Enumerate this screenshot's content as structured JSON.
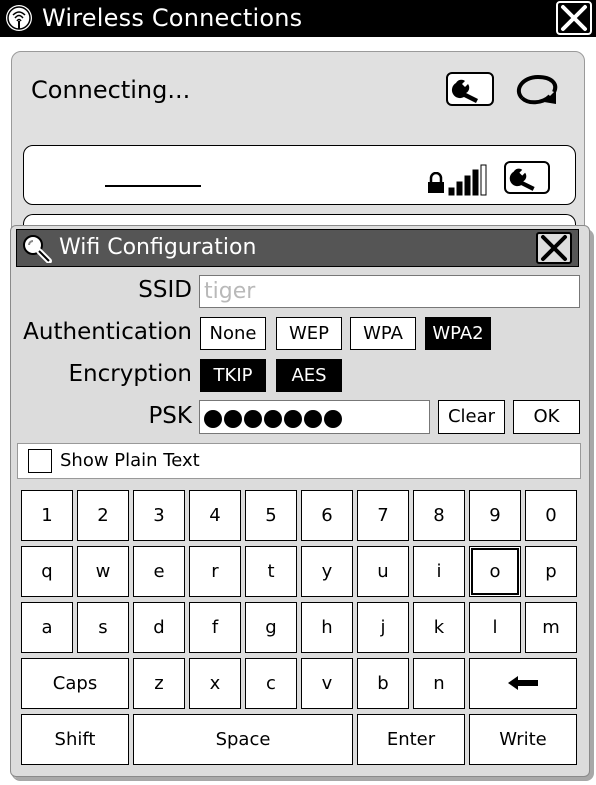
{
  "window": {
    "title": "Wireless Connections"
  },
  "status": {
    "text": "Connecting..."
  },
  "dialog": {
    "title": "Wifi Configuration",
    "ssid": {
      "label": "SSID",
      "placeholder": "tiger"
    },
    "authentication": {
      "label": "Authentication",
      "options": [
        "None",
        "WEP",
        "WPA",
        "WPA2"
      ],
      "selected": "WPA2"
    },
    "encryption": {
      "label": "Encryption",
      "options": [
        "TKIP",
        "AES"
      ],
      "selected": [
        "TKIP",
        "AES"
      ]
    },
    "psk": {
      "label": "PSK",
      "masked_length": 7,
      "clear_label": "Clear",
      "ok_label": "OK"
    },
    "show_plain_text": {
      "label": "Show Plain Text",
      "checked": false
    }
  },
  "keyboard": {
    "row1": [
      "1",
      "2",
      "3",
      "4",
      "5",
      "6",
      "7",
      "8",
      "9",
      "0"
    ],
    "row2": [
      "q",
      "w",
      "e",
      "r",
      "t",
      "y",
      "u",
      "i",
      "o",
      "p"
    ],
    "row3": [
      "a",
      "s",
      "d",
      "f",
      "g",
      "h",
      "j",
      "k",
      "l",
      "m"
    ],
    "row4": [
      "Caps",
      "z",
      "x",
      "c",
      "v",
      "b",
      "n",
      "←"
    ],
    "row5": [
      "Shift",
      "Space",
      "Enter",
      "Write"
    ],
    "focused_key": "o"
  },
  "icons": {
    "app": "wifi-app-icon",
    "close": "close-icon",
    "wrench": "wrench-icon",
    "refresh": "refresh-icon",
    "lock": "lock-icon",
    "signal": "signal-strength-icon",
    "search": "search-icon",
    "backspace": "backspace-arrow-icon"
  }
}
